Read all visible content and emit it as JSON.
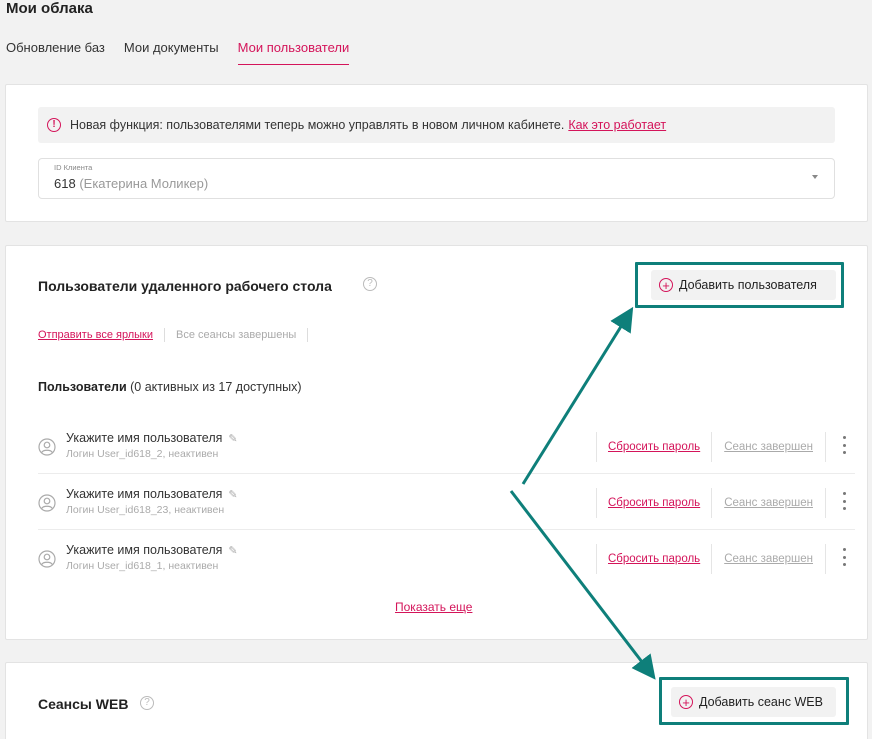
{
  "page": {
    "title": "Мои облака"
  },
  "tabs": [
    {
      "label": "Обновление баз",
      "active": false
    },
    {
      "label": "Мои документы",
      "active": false
    },
    {
      "label": "Мои пользователи",
      "active": true
    }
  ],
  "notice": {
    "text": "Новая функция: пользователями теперь можно управлять в новом личном кабинете.",
    "link": "Как это работает",
    "icon": "info-icon"
  },
  "client_select": {
    "label": "ID Клиента",
    "value": "618",
    "value_note": "(Екатерина Моликер)"
  },
  "rdp_section": {
    "title": "Пользователи удаленного рабочего стола",
    "help": "?",
    "add_button": "Добавить пользователя",
    "send_all_link": "Отправить все ярлыки",
    "sessions_status": "Все сеансы завершены",
    "users_label": "Пользователи",
    "users_count": "(0 активных из 17 доступных)",
    "users": [
      {
        "name": "Укажите имя пользователя",
        "login": "Логин User_id618_2, неактивен",
        "reset": "Сбросить пароль",
        "session": "Сеанс завершен"
      },
      {
        "name": "Укажите имя пользователя",
        "login": "Логин User_id618_23, неактивен",
        "reset": "Сбросить пароль",
        "session": "Сеанс завершен"
      },
      {
        "name": "Укажите имя пользователя",
        "login": "Логин User_id618_1, неактивен",
        "reset": "Сбросить пароль",
        "session": "Сеанс завершен"
      }
    ],
    "show_more": "Показать еще"
  },
  "web_section": {
    "title": "Сеансы WEB",
    "help": "?",
    "add_button": "Добавить сеанс WEB"
  },
  "colors": {
    "accent": "#d4145a",
    "annotation": "#0e7f7a",
    "background": "#f2f2f2"
  }
}
